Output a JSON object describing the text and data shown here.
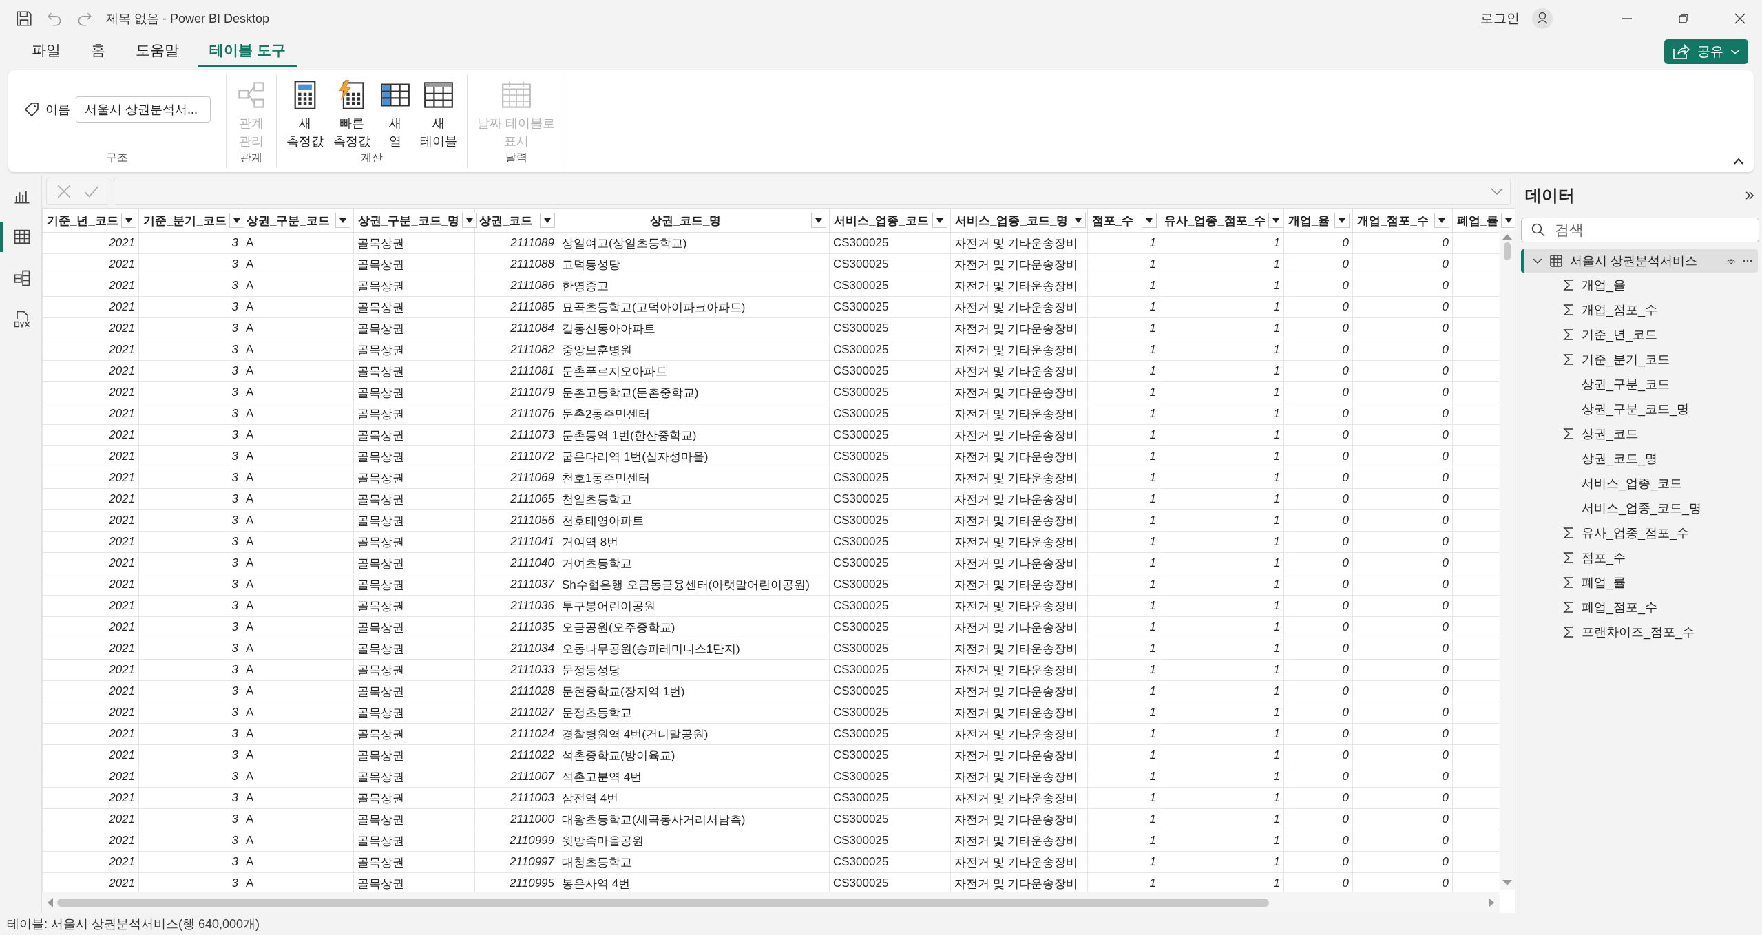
{
  "window": {
    "title": "제목 없음 - Power BI Desktop",
    "signin": "로그인",
    "share": "공유"
  },
  "tabs": [
    {
      "label": "파일",
      "selected": false
    },
    {
      "label": "홈",
      "selected": false
    },
    {
      "label": "도움말",
      "selected": false
    },
    {
      "label": "테이블 도구",
      "selected": true
    }
  ],
  "ribbon": {
    "groups": [
      {
        "label": "구조",
        "kind": "name",
        "field_label": "이름",
        "field_value": "서울시 상권분석서..."
      },
      {
        "label": "관계",
        "kind": "buttons",
        "buttons": [
          {
            "lines": [
              "관계",
              "관리"
            ],
            "disabled": true
          }
        ]
      },
      {
        "label": "계산",
        "kind": "buttons",
        "buttons": [
          {
            "lines": [
              "새",
              "측정값"
            ],
            "disabled": false
          },
          {
            "lines": [
              "빠른",
              "측정값"
            ],
            "disabled": false
          },
          {
            "lines": [
              "새",
              "열"
            ],
            "disabled": false
          },
          {
            "lines": [
              "새",
              "테이블"
            ],
            "disabled": false
          }
        ]
      },
      {
        "label": "달력",
        "kind": "buttons",
        "buttons": [
          {
            "lines": [
              "날짜 테이블로",
              "표시"
            ],
            "disabled": true
          }
        ]
      }
    ]
  },
  "nav": [
    {
      "selected": false
    },
    {
      "selected": true
    },
    {
      "selected": false
    },
    {
      "selected": false
    }
  ],
  "table": {
    "columns": [
      {
        "label": "기준_년_코드",
        "kind": "number"
      },
      {
        "label": "기준_분기_코드",
        "kind": "number"
      },
      {
        "label": "상권_구분_코드",
        "kind": "text"
      },
      {
        "label": "상권_구분_코드_명",
        "kind": "text"
      },
      {
        "label": "상권_코드",
        "kind": "number"
      },
      {
        "label": "상권_코드_명",
        "kind": "text"
      },
      {
        "label": "서비스_업종_코드",
        "kind": "text"
      },
      {
        "label": "서비스_업종_코드_명",
        "kind": "text"
      },
      {
        "label": "점포_수",
        "kind": "number"
      },
      {
        "label": "유사_업종_점포_수",
        "kind": "number"
      },
      {
        "label": "개업_율",
        "kind": "number"
      },
      {
        "label": "개업_점포_수",
        "kind": "number"
      },
      {
        "label": "폐업_률",
        "kind": "number"
      }
    ],
    "rows": [
      [
        "2021",
        "3",
        "A",
        "골목상권",
        "2111089",
        "상일여고(상일초등학교)",
        "CS300025",
        "자전거 및 기타운송장비",
        "1",
        "1",
        "0",
        "0"
      ],
      [
        "2021",
        "3",
        "A",
        "골목상권",
        "2111088",
        "고덕동성당",
        "CS300025",
        "자전거 및 기타운송장비",
        "1",
        "1",
        "0",
        "0"
      ],
      [
        "2021",
        "3",
        "A",
        "골목상권",
        "2111086",
        "한영중고",
        "CS300025",
        "자전거 및 기타운송장비",
        "1",
        "1",
        "0",
        "0"
      ],
      [
        "2021",
        "3",
        "A",
        "골목상권",
        "2111085",
        "묘곡초등학교(고덕아이파크아파트)",
        "CS300025",
        "자전거 및 기타운송장비",
        "1",
        "1",
        "0",
        "0"
      ],
      [
        "2021",
        "3",
        "A",
        "골목상권",
        "2111084",
        "길동신동아아파트",
        "CS300025",
        "자전거 및 기타운송장비",
        "1",
        "1",
        "0",
        "0"
      ],
      [
        "2021",
        "3",
        "A",
        "골목상권",
        "2111082",
        "중앙보훈병원",
        "CS300025",
        "자전거 및 기타운송장비",
        "1",
        "1",
        "0",
        "0"
      ],
      [
        "2021",
        "3",
        "A",
        "골목상권",
        "2111081",
        "둔촌푸르지오아파트",
        "CS300025",
        "자전거 및 기타운송장비",
        "1",
        "1",
        "0",
        "0"
      ],
      [
        "2021",
        "3",
        "A",
        "골목상권",
        "2111079",
        "둔촌고등학교(둔촌중학교)",
        "CS300025",
        "자전거 및 기타운송장비",
        "1",
        "1",
        "0",
        "0"
      ],
      [
        "2021",
        "3",
        "A",
        "골목상권",
        "2111076",
        "둔촌2동주민센터",
        "CS300025",
        "자전거 및 기타운송장비",
        "1",
        "1",
        "0",
        "0"
      ],
      [
        "2021",
        "3",
        "A",
        "골목상권",
        "2111073",
        "둔촌동역 1번(한산중학교)",
        "CS300025",
        "자전거 및 기타운송장비",
        "1",
        "1",
        "0",
        "0"
      ],
      [
        "2021",
        "3",
        "A",
        "골목상권",
        "2111072",
        "굽은다리역 1번(십자성마을)",
        "CS300025",
        "자전거 및 기타운송장비",
        "1",
        "1",
        "0",
        "0"
      ],
      [
        "2021",
        "3",
        "A",
        "골목상권",
        "2111069",
        "천호1동주민센터",
        "CS300025",
        "자전거 및 기타운송장비",
        "1",
        "1",
        "0",
        "0"
      ],
      [
        "2021",
        "3",
        "A",
        "골목상권",
        "2111065",
        "천일초등학교",
        "CS300025",
        "자전거 및 기타운송장비",
        "1",
        "1",
        "0",
        "0"
      ],
      [
        "2021",
        "3",
        "A",
        "골목상권",
        "2111056",
        "천호태영아파트",
        "CS300025",
        "자전거 및 기타운송장비",
        "1",
        "1",
        "0",
        "0"
      ],
      [
        "2021",
        "3",
        "A",
        "골목상권",
        "2111041",
        "거여역 8번",
        "CS300025",
        "자전거 및 기타운송장비",
        "1",
        "1",
        "0",
        "0"
      ],
      [
        "2021",
        "3",
        "A",
        "골목상권",
        "2111040",
        "거여초등학교",
        "CS300025",
        "자전거 및 기타운송장비",
        "1",
        "1",
        "0",
        "0"
      ],
      [
        "2021",
        "3",
        "A",
        "골목상권",
        "2111037",
        "Sh수협은행 오금동금융센터(아랫말어린이공원)",
        "CS300025",
        "자전거 및 기타운송장비",
        "1",
        "1",
        "0",
        "0"
      ],
      [
        "2021",
        "3",
        "A",
        "골목상권",
        "2111036",
        "투구봉어린이공원",
        "CS300025",
        "자전거 및 기타운송장비",
        "1",
        "1",
        "0",
        "0"
      ],
      [
        "2021",
        "3",
        "A",
        "골목상권",
        "2111035",
        "오금공원(오주중학교)",
        "CS300025",
        "자전거 및 기타운송장비",
        "1",
        "1",
        "0",
        "0"
      ],
      [
        "2021",
        "3",
        "A",
        "골목상권",
        "2111034",
        "오동나무공원(송파레미니스1단지)",
        "CS300025",
        "자전거 및 기타운송장비",
        "1",
        "1",
        "0",
        "0"
      ],
      [
        "2021",
        "3",
        "A",
        "골목상권",
        "2111033",
        "문정동성당",
        "CS300025",
        "자전거 및 기타운송장비",
        "1",
        "1",
        "0",
        "0"
      ],
      [
        "2021",
        "3",
        "A",
        "골목상권",
        "2111028",
        "문현중학교(장지역 1번)",
        "CS300025",
        "자전거 및 기타운송장비",
        "1",
        "1",
        "0",
        "0"
      ],
      [
        "2021",
        "3",
        "A",
        "골목상권",
        "2111027",
        "문정초등학교",
        "CS300025",
        "자전거 및 기타운송장비",
        "1",
        "1",
        "0",
        "0"
      ],
      [
        "2021",
        "3",
        "A",
        "골목상권",
        "2111024",
        "경찰병원역 4번(건너말공원)",
        "CS300025",
        "자전거 및 기타운송장비",
        "1",
        "1",
        "0",
        "0"
      ],
      [
        "2021",
        "3",
        "A",
        "골목상권",
        "2111022",
        "석촌중학교(방이육교)",
        "CS300025",
        "자전거 및 기타운송장비",
        "1",
        "1",
        "0",
        "0"
      ],
      [
        "2021",
        "3",
        "A",
        "골목상권",
        "2111007",
        "석촌고분역 4번",
        "CS300025",
        "자전거 및 기타운송장비",
        "1",
        "1",
        "0",
        "0"
      ],
      [
        "2021",
        "3",
        "A",
        "골목상권",
        "2111003",
        "삼전역 4번",
        "CS300025",
        "자전거 및 기타운송장비",
        "1",
        "1",
        "0",
        "0"
      ],
      [
        "2021",
        "3",
        "A",
        "골목상권",
        "2111000",
        "대왕초등학교(세곡동사거리서남측)",
        "CS300025",
        "자전거 및 기타운송장비",
        "1",
        "1",
        "0",
        "0"
      ],
      [
        "2021",
        "3",
        "A",
        "골목상권",
        "2110999",
        "윗방죽마을공원",
        "CS300025",
        "자전거 및 기타운송장비",
        "1",
        "1",
        "0",
        "0"
      ],
      [
        "2021",
        "3",
        "A",
        "골목상권",
        "2110997",
        "대청초등학교",
        "CS300025",
        "자전거 및 기타운송장비",
        "1",
        "1",
        "0",
        "0"
      ],
      [
        "2021",
        "3",
        "A",
        "골목상권",
        "2110995",
        "봉은사역 4번",
        "CS300025",
        "자전거 및 기타운송장비",
        "1",
        "1",
        "0",
        "0"
      ]
    ]
  },
  "data_pane": {
    "title": "데이터",
    "search": {
      "placeholder": "검색"
    },
    "table": {
      "label": "서울시 상권분석서비스",
      "expanded": true,
      "selected": true,
      "children": [
        {
          "label": "개업_율",
          "kind": "measure"
        },
        {
          "label": "개업_점포_수",
          "kind": "measure"
        },
        {
          "label": "기준_년_코드",
          "kind": "measure"
        },
        {
          "label": "기준_분기_코드",
          "kind": "measure"
        },
        {
          "label": "상권_구분_코드",
          "kind": "text"
        },
        {
          "label": "상권_구분_코드_명",
          "kind": "text"
        },
        {
          "label": "상권_코드",
          "kind": "measure"
        },
        {
          "label": "상권_코드_명",
          "kind": "text"
        },
        {
          "label": "서비스_업종_코드",
          "kind": "text"
        },
        {
          "label": "서비스_업종_코드_명",
          "kind": "text"
        },
        {
          "label": "유사_업종_점포_수",
          "kind": "measure"
        },
        {
          "label": "점포_수",
          "kind": "measure"
        },
        {
          "label": "폐업_률",
          "kind": "measure"
        },
        {
          "label": "폐업_점포_수",
          "kind": "measure"
        },
        {
          "label": "프랜차이즈_점포_수",
          "kind": "measure"
        }
      ]
    }
  },
  "status_bar": "테이블: 서울시 상권분석서비스(행 640,000개)"
}
